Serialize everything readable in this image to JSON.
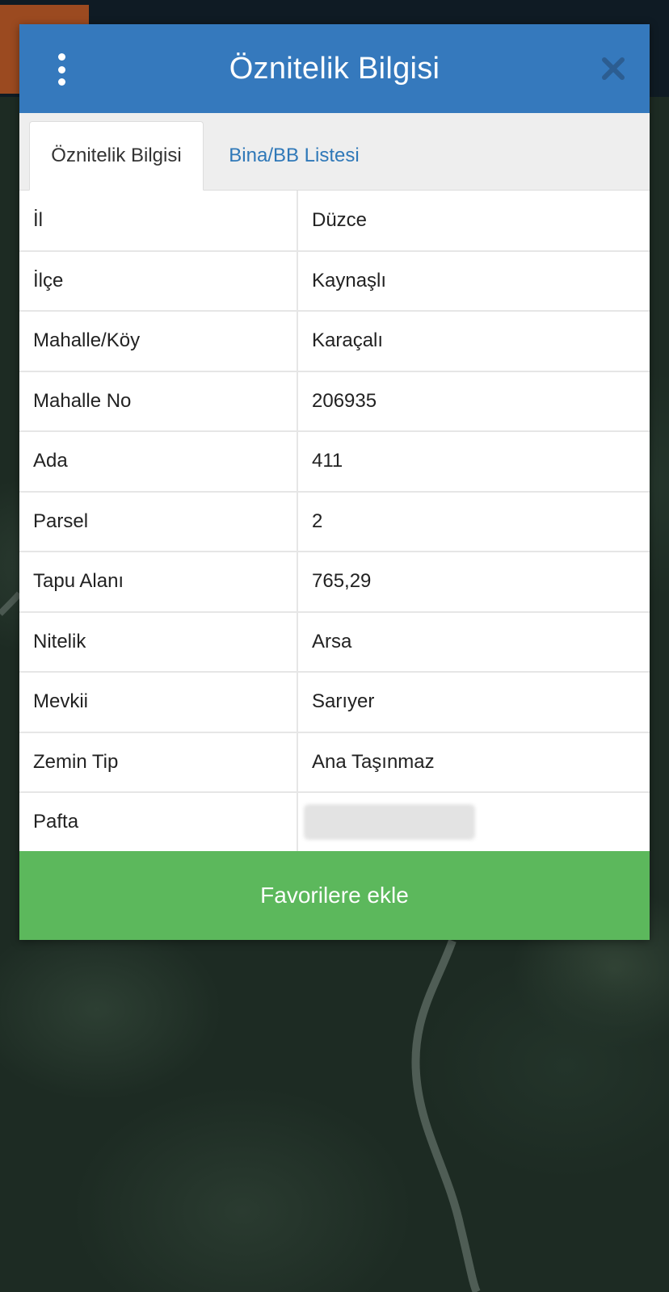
{
  "modal": {
    "title": "Öznitelik Bilgisi",
    "header_color": "#3579bd"
  },
  "tabs": [
    {
      "label": "Öznitelik Bilgisi",
      "active": true
    },
    {
      "label": "Bina/BB Listesi",
      "active": false
    }
  ],
  "attributes": [
    {
      "key": "İl",
      "value": "Düzce"
    },
    {
      "key": "İlçe",
      "value": "Kaynaşlı"
    },
    {
      "key": "Mahalle/Köy",
      "value": "Karaçalı"
    },
    {
      "key": "Mahalle No",
      "value": "206935"
    },
    {
      "key": "Ada",
      "value": "411"
    },
    {
      "key": "Parsel",
      "value": "2"
    },
    {
      "key": "Tapu Alanı",
      "value": "765,29"
    },
    {
      "key": "Nitelik",
      "value": "Arsa"
    },
    {
      "key": "Mevkii",
      "value": "Sarıyer"
    },
    {
      "key": "Zemin Tip",
      "value": "Ana Taşınmaz"
    },
    {
      "key": "Pafta",
      "value": "",
      "redacted": true
    }
  ],
  "actions": {
    "favorite_label": "Favorilere ekle",
    "favorite_color": "#5cb85c"
  },
  "icons": {
    "menu": "vertical-dots-icon",
    "close": "close-icon"
  }
}
